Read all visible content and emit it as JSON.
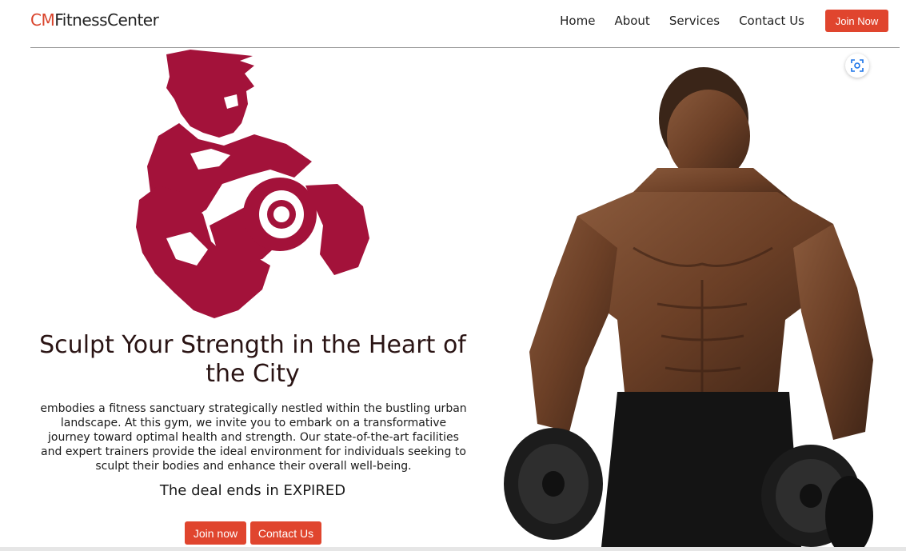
{
  "brand": {
    "prefix": "CM",
    "name": "FitnessCenter"
  },
  "nav": {
    "items": [
      "Home",
      "About",
      "Services",
      "Contact Us"
    ],
    "join_label": "Join Now"
  },
  "hero": {
    "title": "Sculpt Your Strength in the Heart of the City",
    "description": "embodies a fitness sanctuary strategically nestled within the bustling urban landscape. At this gym, we invite you to embark on a transformative journey toward optimal health and strength. Our state-of-the-art facilities and expert trainers provide the ideal environment for individuals seeking to sculpt their bodies and enhance their overall well-being.",
    "deal_prefix": "The deal ends in",
    "deal_status": "EXPIRED",
    "join_button": "Join now",
    "contact_button": "Contact Us"
  },
  "icons": {
    "logo": "bodybuilder-logo-icon",
    "lens": "visual-search-icon"
  },
  "colors": {
    "accent": "#e0452e",
    "logo": "#a3123a",
    "text_dark": "#2a1414"
  }
}
